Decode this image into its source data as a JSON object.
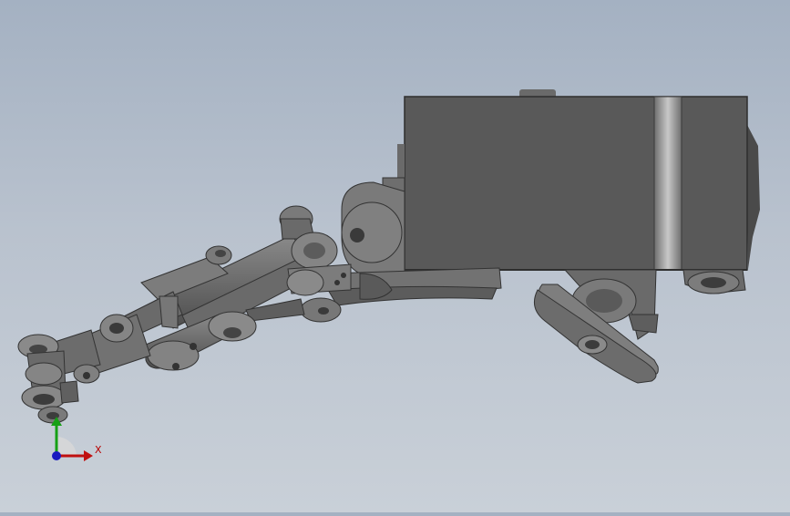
{
  "viewport": {
    "background_top": "#a4b1c2",
    "background_bottom": "#c9d0d8",
    "part_color": "#6d6d6d"
  },
  "triad": {
    "x_label": "X",
    "x_color": "#c01010",
    "y_color": "#16a016",
    "z_color": "#1a1ac0"
  }
}
